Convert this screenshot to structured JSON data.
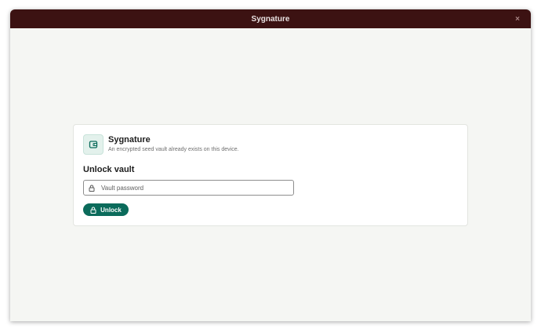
{
  "window": {
    "title": "Sygnature",
    "close_glyph": "×"
  },
  "card": {
    "app_icon": "wallet-icon",
    "app_name": "Sygnature",
    "app_description": "An encrypted seed vault already exists on this device.",
    "section_title": "Unlock vault",
    "password_field": {
      "icon": "lock-icon",
      "placeholder": "Vault password",
      "value": ""
    },
    "unlock_button": {
      "icon": "lock-icon",
      "label": "Unlock"
    }
  },
  "colors": {
    "titlebar": "#3c1212",
    "background": "#f5f6f3",
    "accent": "#0b6b5b",
    "icon_tint_bg": "#e3f1ec"
  }
}
